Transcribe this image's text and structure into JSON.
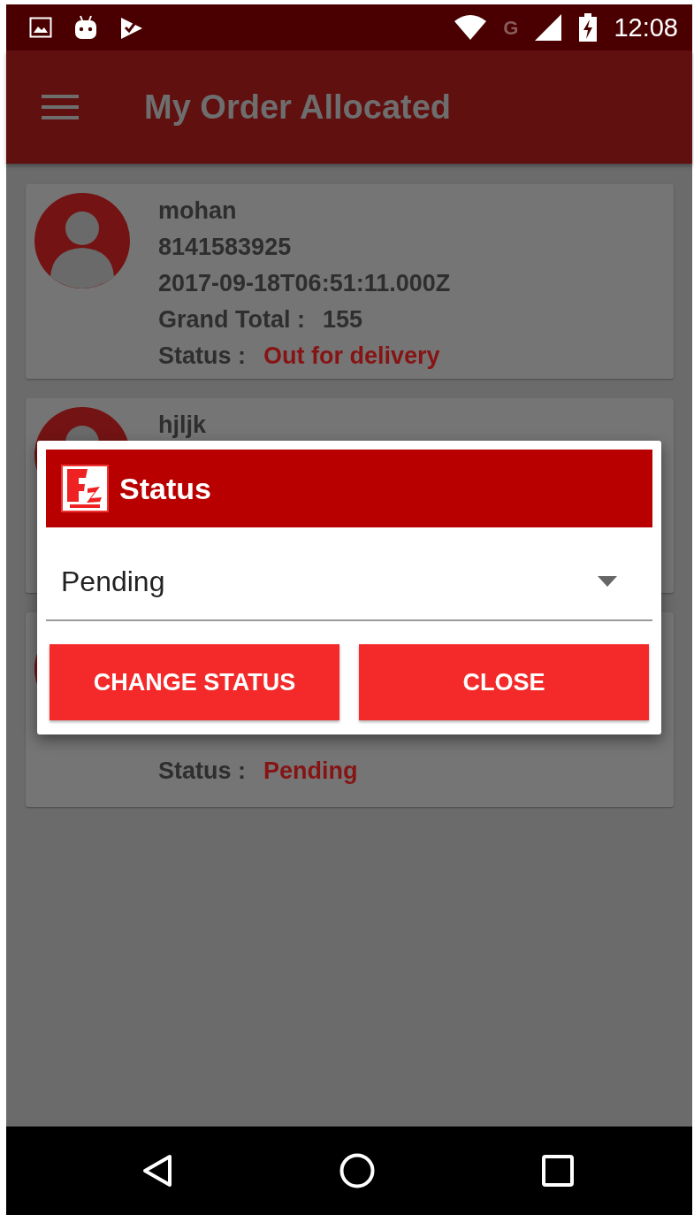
{
  "status_bar": {
    "network": "G",
    "time": "12:08"
  },
  "app_bar": {
    "title": "My Order Allocated"
  },
  "orders": [
    {
      "name": "mohan",
      "phone": "8141583925",
      "date": "2017-09-18T06:51:11.000Z",
      "total_label": "Grand Total :",
      "total": "155",
      "status_label": "Status :",
      "status": "Out for delivery"
    },
    {
      "name": "hjljk"
    },
    {
      "status_label": "Status :",
      "status": "Pending"
    }
  ],
  "dialog": {
    "title": "Status",
    "dropdown": {
      "value": "Pending"
    },
    "buttons": [
      "CHANGE STATUS",
      "CLOSE"
    ]
  }
}
